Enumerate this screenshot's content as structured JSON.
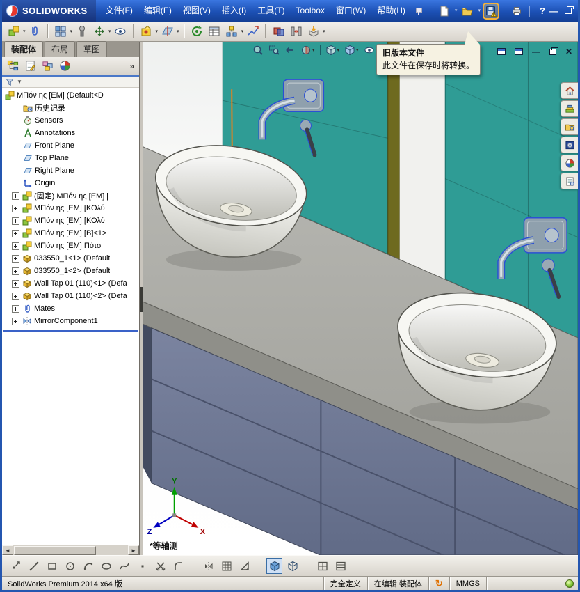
{
  "titlebar": {
    "logo_text": "SOLIDWORKS",
    "menus": [
      "文件(F)",
      "编辑(E)",
      "视图(V)",
      "插入(I)",
      "工具(T)",
      "Toolbox",
      "窗口(W)",
      "帮助(H)"
    ]
  },
  "glyphs": {
    "caret": "▾",
    "chevron": "»",
    "minimize": "—",
    "close": "✕",
    "help": "?",
    "scroll_left": "◄",
    "scroll_right": "►",
    "refresh": "↻",
    "filter_caret": "▼"
  },
  "tooltip": {
    "title": "旧版本文件",
    "body": "此文件在保存时将转换。"
  },
  "panel": {
    "tabs": [
      {
        "label": "装配体"
      },
      {
        "label": "布局"
      },
      {
        "label": "草图"
      }
    ],
    "root_label": "MΠόν ης [EM] (Default<D",
    "items": [
      {
        "label": "历史记录"
      },
      {
        "label": "Sensors"
      },
      {
        "label": "Annotations"
      },
      {
        "label": "Front Plane"
      },
      {
        "label": "Top Plane"
      },
      {
        "label": "Right Plane"
      },
      {
        "label": "Origin"
      },
      {
        "label": "(固定) MΠόν ης [EM] ["
      },
      {
        "label": "MΠόν ης [EM] [ΚΟλύ"
      },
      {
        "label": "MΠόν ης [EM] [ΚΟλύ"
      },
      {
        "label": "MΠόν ης [EM] [B]<1>"
      },
      {
        "label": "MΠόν ης [EM] Πότσ"
      },
      {
        "label": "033550_1<1> (Default"
      },
      {
        "label": "033550_1<2> (Default"
      },
      {
        "label": "Wall Tap 01 (110)<1> (Defa"
      },
      {
        "label": "Wall Tap 01 (110)<2> (Defa"
      },
      {
        "label": "Mates"
      },
      {
        "label": "MirrorComponent1"
      }
    ]
  },
  "viewport": {
    "view_label": "*等轴测",
    "axes": {
      "x": "X",
      "y": "Y",
      "z": "Z"
    }
  },
  "statusbar": {
    "product": "SolidWorks Premium 2014 x64 版",
    "fully_defined": "完全定义",
    "editing": "在编辑 装配体",
    "units": "MMGS"
  },
  "colors": {
    "wall_panel_teal": "#2f9c95",
    "cabinet_blue_gray": "#6f7994",
    "countertop_gray": "#a9a9a4",
    "selection_blue": "#2b50d4",
    "highlight_orange": "#e5821e",
    "titlebar_blue": "#1f55b8"
  }
}
